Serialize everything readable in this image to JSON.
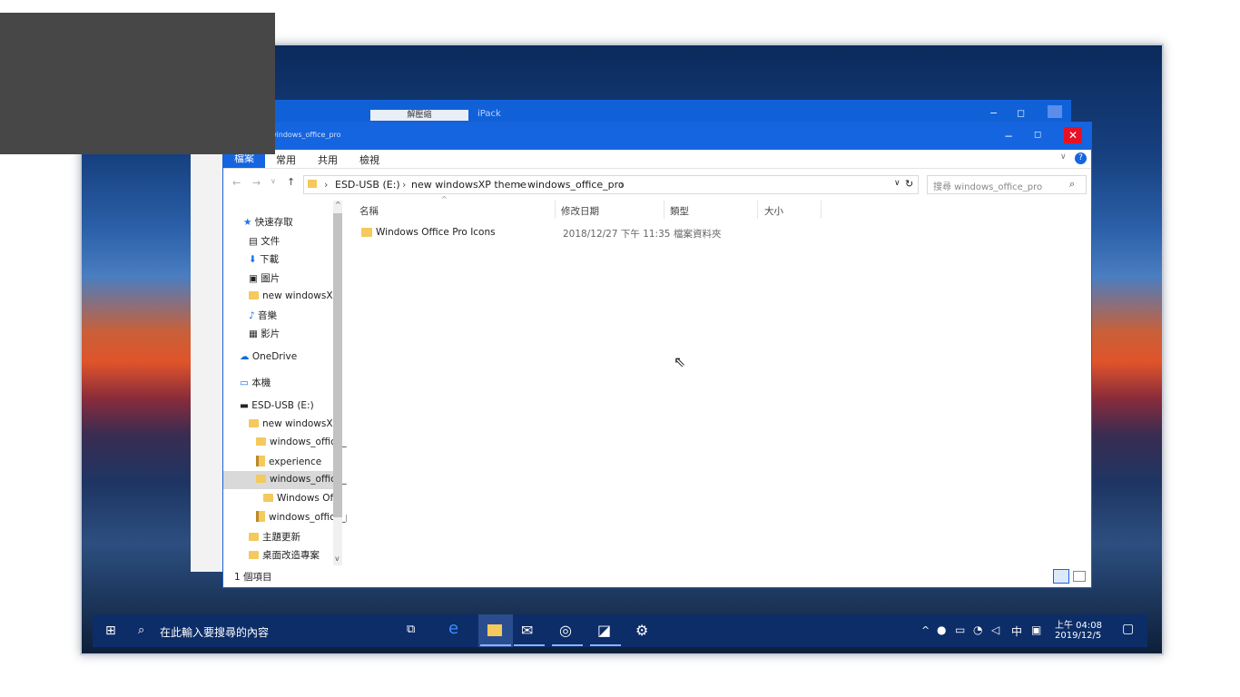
{
  "back_window": {
    "title_label": "解壓縮",
    "app_name": "iPack"
  },
  "window": {
    "title": "windows_office_pro",
    "ribbon_tabs": [
      "檔案",
      "常用",
      "共用",
      "檢視"
    ],
    "nav_back": "←",
    "nav_forward": "→",
    "nav_up": "↑",
    "address_path": [
      "ESD-USB (E:)",
      "new windowsXP theme",
      "windows_office_pro"
    ],
    "search_placeholder": "搜尋 windows_office_pro",
    "nav_items": [
      {
        "label": "快速存取",
        "icon": "star-icon"
      },
      {
        "label": "文件",
        "icon": "document-icon"
      },
      {
        "label": "下載",
        "icon": "download-icon"
      },
      {
        "label": "圖片",
        "icon": "pictures-icon"
      },
      {
        "label": "new windowsXP theme",
        "icon": "folder-icon"
      },
      {
        "label": "音樂",
        "icon": "music-icon"
      },
      {
        "label": "影片",
        "icon": "video-icon"
      },
      {
        "label": "OneDrive",
        "icon": "cloud-icon"
      },
      {
        "label": "本機",
        "icon": "computer-icon"
      },
      {
        "label": "ESD-USB (E:)",
        "icon": "drive-icon"
      },
      {
        "label": "new windowsXP theme",
        "icon": "folder-icon"
      },
      {
        "label": "windows_office_pro",
        "icon": "folder-icon"
      },
      {
        "label": "experience",
        "icon": "zip-icon"
      },
      {
        "label": "windows_office_pro",
        "icon": "folder-icon"
      },
      {
        "label": "Windows Office Pro Icons",
        "icon": "folder-icon"
      },
      {
        "label": "windows_office_pro",
        "icon": "zip-icon"
      },
      {
        "label": "主題更新",
        "icon": "folder-icon"
      },
      {
        "label": "桌面改造專案",
        "icon": "folder-icon"
      }
    ],
    "columns": [
      "名稱",
      "修改日期",
      "類型",
      "大小"
    ],
    "files": [
      {
        "name": "Windows Office Pro Icons",
        "modified": "2018/12/27 下午 11:35",
        "type": "檔案資料夾",
        "size": ""
      }
    ],
    "status_text": "1 個項目"
  },
  "taskbar": {
    "search_placeholder": "在此輸入要搜尋的內容",
    "ime_label": "中",
    "time": "上午 04:08",
    "date": "2019/12/5"
  },
  "colors": {
    "titlebar": "#1565e0",
    "taskbar": "#0c2d68",
    "close_button": "#e81123",
    "folder": "#f4c95d"
  }
}
